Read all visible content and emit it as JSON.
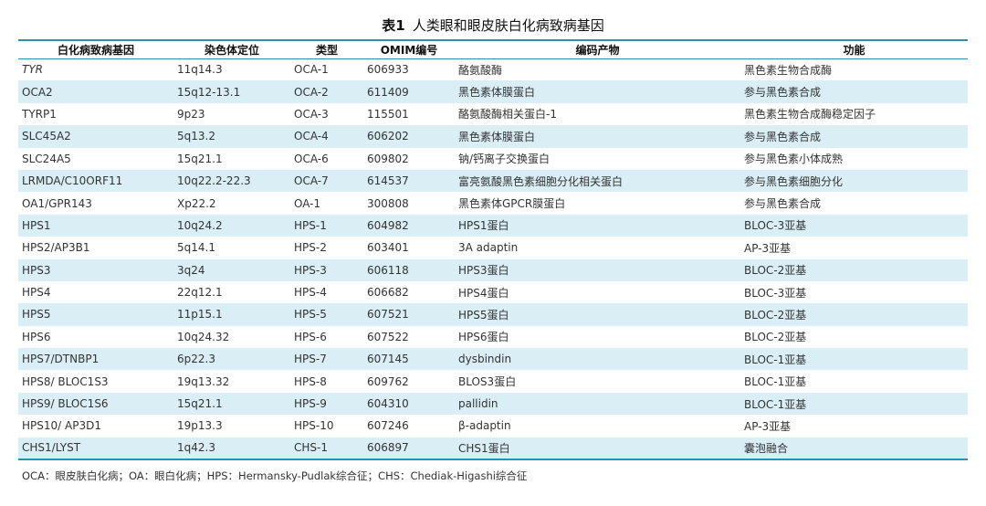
{
  "title": {
    "label": "表1",
    "text": "人类眼和眼皮肤白化病致病基因"
  },
  "table": {
    "headers": [
      "白化病致病基因",
      "染色体定位",
      "类型",
      "OMIM编号",
      "编码产物",
      "功能"
    ],
    "rows": [
      [
        "TYR",
        "11q14.3",
        "OCA-1",
        "606933",
        "酪氨酸酶",
        "黑色素生物合成酶"
      ],
      [
        "OCA2",
        "15q12-13.1",
        "OCA-2",
        "611409",
        "黑色素体膜蛋白",
        "参与黑色素合成"
      ],
      [
        "TYRP1",
        "9p23",
        "OCA-3",
        "115501",
        "酪氨酸酶相关蛋白-1",
        "黑色素生物合成酶稳定因子"
      ],
      [
        "SLC45A2",
        "5q13.2",
        "OCA-4",
        "606202",
        "黑色素体膜蛋白",
        "参与黑色素合成"
      ],
      [
        "SLC24A5",
        "15q21.1",
        "OCA-6",
        "609802",
        "钠/钙离子交换蛋白",
        "参与黑色素小体成熟"
      ],
      [
        "LRMDA/C10ORF11",
        "10q22.2-22.3",
        "OCA-7",
        "614537",
        "富亮氨酸黑色素细胞分化相关蛋白",
        "参与黑色素细胞分化"
      ],
      [
        "OA1/GPR143",
        "Xp22.2",
        "OA-1",
        "300808",
        "黑色素体GPCR膜蛋白",
        "参与黑色素合成"
      ],
      [
        "HPS1",
        "10q24.2",
        "HPS-1",
        "604982",
        "HPS1蛋白",
        "BLOC-3亚基"
      ],
      [
        "HPS2/AP3B1",
        "5q14.1",
        "HPS-2",
        "603401",
        "3A adaptin",
        "AP-3亚基"
      ],
      [
        "HPS3",
        "3q24",
        "HPS-3",
        "606118",
        "HPS3蛋白",
        "BLOC-2亚基"
      ],
      [
        "HPS4",
        "22q12.1",
        "HPS-4",
        "606682",
        "HPS4蛋白",
        "BLOC-3亚基"
      ],
      [
        "HPS5",
        "11p15.1",
        "HPS-5",
        "607521",
        "HPS5蛋白",
        "BLOC-2亚基"
      ],
      [
        "HPS6",
        "10q24.32",
        "HPS-6",
        "607522",
        "HPS6蛋白",
        "BLOC-2亚基"
      ],
      [
        "HPS7/DTNBP1",
        "6p22.3",
        "HPS-7",
        "607145",
        "dysbindin",
        "BLOC-1亚基"
      ],
      [
        "HPS8/ BLOC1S3",
        "19q13.32",
        "HPS-8",
        "609762",
        "BLOS3蛋白",
        "BLOC-1亚基"
      ],
      [
        "HPS9/ BLOC1S6",
        "15q21.1",
        "HPS-9",
        "604310",
        "pallidin",
        "BLOC-1亚基"
      ],
      [
        "HPS10/ AP3D1",
        "19p13.3",
        "HPS-10",
        "607246",
        "β-adaptin",
        "AP-3亚基"
      ],
      [
        "CHS1/LYST",
        "1q42.3",
        "CHS-1",
        "606897",
        "CHS1蛋白",
        "囊泡融合"
      ]
    ]
  },
  "footnote": "OCA：眼皮肤白化病；OA：眼白化病；HPS：Hermansky-Pudlak综合征；CHS：Chediak-Higashi综合征",
  "colors": {
    "accent_line": "#2e8fb0",
    "stripe": "#d9eef5"
  }
}
